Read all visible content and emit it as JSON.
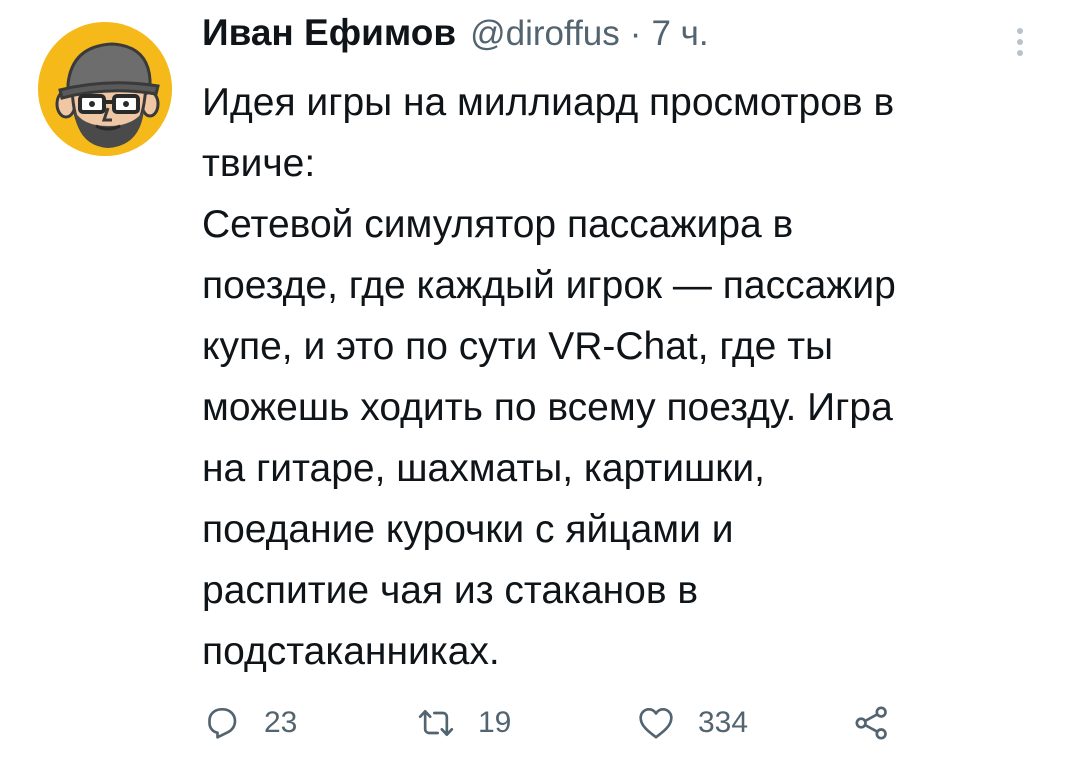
{
  "tweet": {
    "display_name": "Иван Ефимов",
    "handle": "@diroffus",
    "separator": "·",
    "time": "7 ч.",
    "text_lines": [
      "Идея игры на миллиард просмотров в",
      "твиче:",
      "Сетевой симулятор пассажира в",
      "поезде, где каждый игрок — пассажир",
      "купе, и это по сути VR-Chat, где ты",
      "можешь ходить по всему поезду. Игра",
      "на гитаре, шахматы, картишки,",
      "поедание курочки с яйцами и",
      "распитие чая из стаканов в",
      "подстаканниках."
    ]
  },
  "actions": {
    "reply": {
      "icon": "reply-icon",
      "count": "23"
    },
    "retweet": {
      "icon": "retweet-icon",
      "count": "19"
    },
    "like": {
      "icon": "heart-icon",
      "count": "334"
    },
    "share": {
      "icon": "share-icon"
    }
  },
  "colors": {
    "avatar_bg": "#f5b91a",
    "text": "#0f1419",
    "secondary": "#536471",
    "icon": "#536471"
  }
}
